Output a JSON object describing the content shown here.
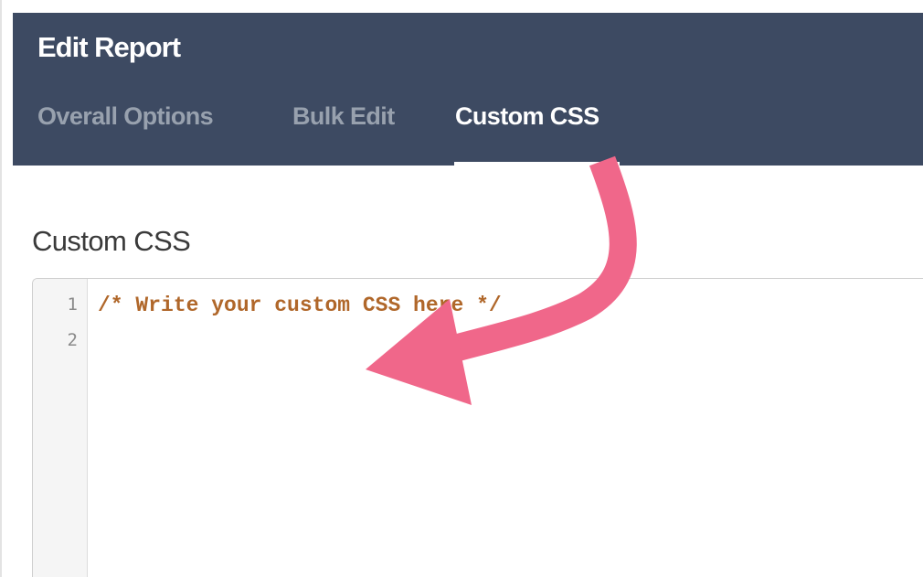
{
  "header": {
    "title": "Edit Report",
    "tabs": [
      {
        "label": "Overall Options",
        "active": false
      },
      {
        "label": "Bulk Edit",
        "active": false
      },
      {
        "label": "Custom CSS",
        "active": true
      }
    ]
  },
  "main": {
    "section_title": "Custom CSS",
    "editor": {
      "line_numbers": [
        "1",
        "2"
      ],
      "lines": [
        "/* Write your custom CSS here */",
        ""
      ]
    }
  },
  "annotation": {
    "arrow_color": "#f0678a",
    "icon": "curved-arrow-icon"
  },
  "colors": {
    "header_bg": "#3d4a62",
    "tab_inactive": "#98a1ae",
    "tab_active": "#ffffff",
    "code_comment": "#b0672a"
  }
}
